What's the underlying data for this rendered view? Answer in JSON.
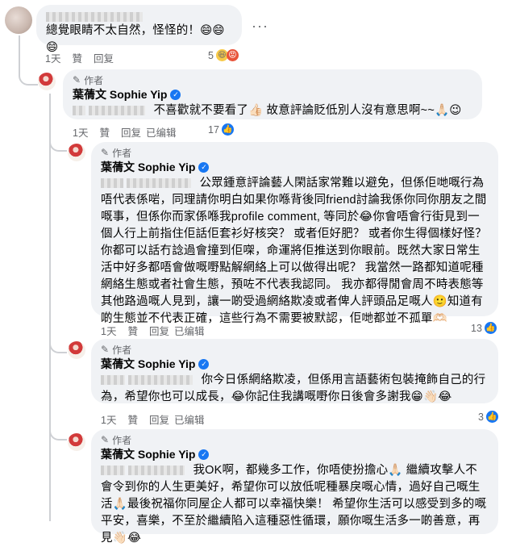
{
  "c1": {
    "text": "總覺眼睛不太自然，怪怪的！",
    "emojis": "😄😄😄",
    "time": "1天",
    "like": "贊",
    "reply": "回复",
    "count": "5",
    "more": "···"
  },
  "c2": {
    "author_badge": "作者",
    "name": "葉蒨文 Sophie Yip",
    "text": "不喜歡就不要看了👍🏻 故意評論貶低別人沒有意思啊~~🙏🏻😉",
    "time": "1天",
    "like": "贊",
    "reply": "回复",
    "edited": "已编辑",
    "count": "17"
  },
  "c3": {
    "author_badge": "作者",
    "name": "葉蒨文 Sophie Yip",
    "text": "公眾鍾意評論藝人閑話家常難以避免，但係佢哋嘅行為唔代表係啱，同理請你明白如果你喺背後同friend討論我係你同你朋友之間嘅事，但係你而家係喺我profile comment, 等同於😂你會唔會行街見到一個人行上前指住佢話佢套衫好核突？ 或者佢好肥？ 或者你生得個樣好怪？ 你都可以話冇諗過會撞到佢㗎，命運將佢推送到你眼前。既然大家日常生活中好多都唔會做嘅嘢點解網絡上可以做得出呢？ 我當然一路都知道呢種網絡生態或者社會生態，預咗不代表我認同。 我亦都得閒會周不時表態等其他路過嘅人見到，讓一啲受過網絡欺凌或者俾人評頭品足嘅人🙂知道有啲生態並不代表正確，這些行為不需要被默認，佢哋都並不孤單🫶🏻",
    "time": "1天",
    "like": "贊",
    "reply": "回复",
    "edited": "已编辑",
    "count": "13"
  },
  "c4": {
    "author_badge": "作者",
    "name": "葉蒨文 Sophie Yip",
    "text": "你今日係網絡欺凌，但係用言語藝術包裝掩飾自己的行為，希望你也可以成長，😂你記住我講嘅嘢你日後會多謝我😁👋🏻😂",
    "time": "1天",
    "like": "贊",
    "reply": "回复",
    "edited": "已编辑",
    "count": "3"
  },
  "c5": {
    "author_badge": "作者",
    "name": "葉蒨文 Sophie Yip",
    "text": "我OK啊，都幾多工作，你唔使扮擔心🙏🏻 繼續攻擊人不會令到你的人生更美好，希望你可以放低呢種暴戾嘅心情，過好自己嘅生活🙏🏻最後祝福你同屋企人都可以幸福快樂！ 希望你生活可以感受到多的嘅平安，喜樂，不至於繼續陷入這種惡性循環，願你嘅生活多一啲善意，再見👋🏻😂"
  }
}
